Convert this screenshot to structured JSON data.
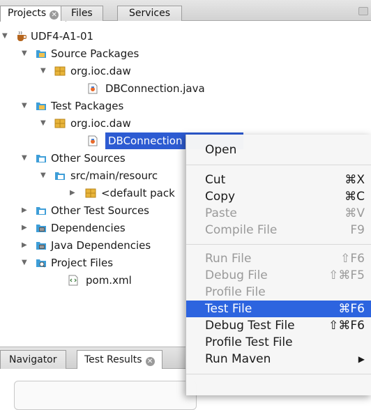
{
  "tabs": {
    "projects": "Projects",
    "files": "Files",
    "services": "Services",
    "close_glyph": "✕"
  },
  "tree": {
    "project": "UDF4-A1-01",
    "source_packages": "Source Packages",
    "source_pkg": "org.ioc.daw",
    "source_file": "DBConnection.java",
    "test_packages": "Test Packages",
    "test_pkg": "org.ioc.daw",
    "test_file": "DBConnection",
    "other_sources": "Other Sources",
    "resources": "src/main/resourc",
    "default_pkg": "<default pack",
    "other_test_sources": "Other Test Sources",
    "dependencies": "Dependencies",
    "java_dependencies": "Java Dependencies",
    "project_files": "Project Files",
    "pom": "pom.xml"
  },
  "bottom_tabs": {
    "navigator": "Navigator",
    "test_results": "Test Results"
  },
  "menu": {
    "open": "Open",
    "cut": "Cut",
    "cut_sc": "⌘X",
    "copy": "Copy",
    "copy_sc": "⌘C",
    "paste": "Paste",
    "paste_sc": "⌘V",
    "compile": "Compile File",
    "compile_sc": "F9",
    "run": "Run File",
    "run_sc": "⇧F6",
    "debug": "Debug File",
    "debug_sc": "⇧⌘F5",
    "profile": "Profile File",
    "test": "Test File",
    "test_sc": "⌘F6",
    "debug_test": "Debug Test File",
    "debug_test_sc": "⇧⌘F6",
    "profile_test": "Profile Test File",
    "run_maven": "Run Maven",
    "run_maven_arrow": "▶"
  },
  "colors": {
    "selection": "#2d5bd2",
    "menu_highlight": "#2d64df",
    "package_yellow": "#e8b43a",
    "folder_blue": "#3e9ed8"
  },
  "icons": [
    "tree-expand-icon",
    "tree-collapse-icon",
    "maven-project-icon",
    "source-folder-icon",
    "package-icon",
    "java-file-icon",
    "library-icon",
    "project-files-icon",
    "xml-file-icon",
    "tab-close-icon",
    "submenu-arrow-icon"
  ]
}
